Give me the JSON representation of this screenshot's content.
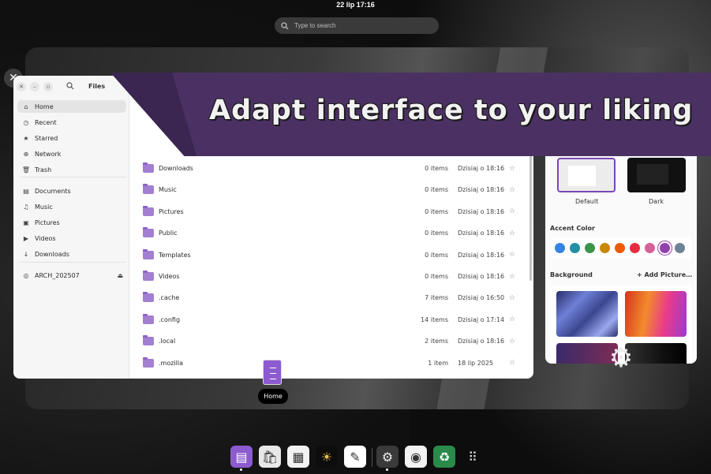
{
  "topbar": {
    "clock": "22 lip  17:16",
    "search_placeholder": "Type to search"
  },
  "files": {
    "title": "Files",
    "sidebar": [
      {
        "label": "Home",
        "icon": "home-icon",
        "glyph": "⌂"
      },
      {
        "label": "Recent",
        "icon": "clock-icon",
        "glyph": "◷"
      },
      {
        "label": "Starred",
        "icon": "star-icon",
        "glyph": "★"
      },
      {
        "label": "Network",
        "icon": "network-icon",
        "glyph": "⊕"
      },
      {
        "label": "Trash",
        "icon": "trash-icon",
        "glyph": "🗑"
      },
      {
        "label": "Documents",
        "icon": "document-icon",
        "glyph": "▤"
      },
      {
        "label": "Music",
        "icon": "music-icon",
        "glyph": "♫"
      },
      {
        "label": "Pictures",
        "icon": "picture-icon",
        "glyph": "▣"
      },
      {
        "label": "Videos",
        "icon": "video-icon",
        "glyph": "▶"
      },
      {
        "label": "Downloads",
        "icon": "download-icon",
        "glyph": "↓"
      },
      {
        "label": "ARCH_202507",
        "icon": "disc-icon",
        "glyph": "◎"
      }
    ],
    "rows": [
      {
        "name": "Downloads",
        "count": "0 items",
        "date": "Dzisiaj o 18:16"
      },
      {
        "name": "Music",
        "count": "0 items",
        "date": "Dzisiaj o 18:16"
      },
      {
        "name": "Pictures",
        "count": "0 items",
        "date": "Dzisiaj o 18:16"
      },
      {
        "name": "Public",
        "count": "0 items",
        "date": "Dzisiaj o 18:16"
      },
      {
        "name": "Templates",
        "count": "0 items",
        "date": "Dzisiaj o 18:16"
      },
      {
        "name": "Videos",
        "count": "0 items",
        "date": "Dzisiaj o 18:16"
      },
      {
        "name": ".cache",
        "count": "7 items",
        "date": "Dzisiaj o 16:50"
      },
      {
        "name": ".config",
        "count": "14 items",
        "date": "Dzisiaj o 17:14"
      },
      {
        "name": ".local",
        "count": "2 items",
        "date": "Dzisiaj o 18:16"
      },
      {
        "name": ".mozilla",
        "count": "1 item",
        "date": "18 lip 2025"
      }
    ]
  },
  "settings": {
    "theme_default": "Default",
    "theme_dark": "Dark",
    "accent_label": "Accent Color",
    "accent_colors": [
      "#3584e4",
      "#2190a4",
      "#3a944a",
      "#c88800",
      "#ed5b00",
      "#e62d42",
      "#d56199",
      "#9141ac",
      "#6f8396"
    ],
    "background_label": "Background",
    "add_picture": "+ Add Picture…"
  },
  "banner": {
    "text": "Adapt interface to your liking"
  },
  "tooltip": {
    "home": "Home"
  },
  "dock": [
    {
      "name": "files-icon",
      "bg": "#8d5bd0",
      "glyph": "▤"
    },
    {
      "name": "software-icon",
      "bg": "#e8e8e8",
      "glyph": "🛍"
    },
    {
      "name": "calendar-icon",
      "bg": "#f2f2f2",
      "glyph": "▦"
    },
    {
      "name": "weather-icon",
      "bg": "#0d0d0d",
      "glyph": "☀"
    },
    {
      "name": "text-editor-icon",
      "bg": "#ffffff",
      "glyph": "✎"
    },
    {
      "name": "settings-icon",
      "bg": "#3a3a3a",
      "glyph": "⚙"
    },
    {
      "name": "disk-icon",
      "bg": "#f2f2f2",
      "glyph": "◉"
    },
    {
      "name": "archive-icon",
      "bg": "#2a8a4a",
      "glyph": "♻"
    },
    {
      "name": "app-grid-icon",
      "bg": "transparent",
      "glyph": "⠿"
    }
  ]
}
